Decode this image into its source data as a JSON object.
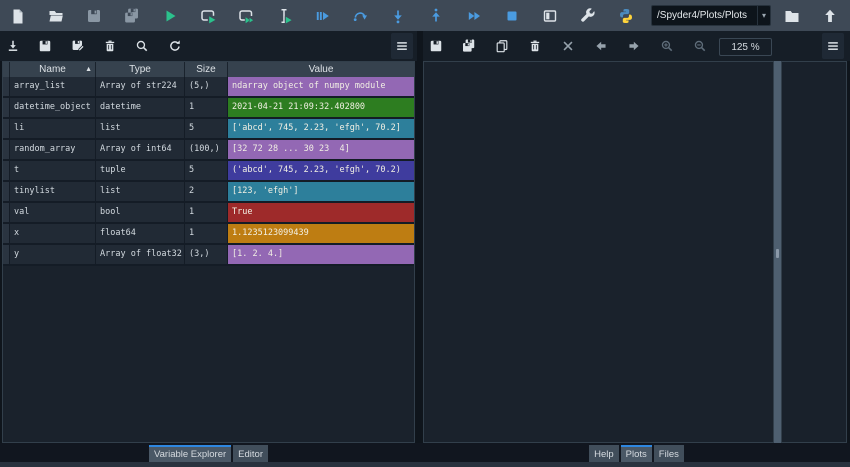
{
  "main_toolbar": {
    "icons": [
      "new-file",
      "open-file",
      "save",
      "save-all",
      "run",
      "run-cell",
      "run-cell-advance",
      "run-selection",
      "debug-file",
      "rerun-cell",
      "step-into",
      "step-return",
      "continue",
      "stop",
      "maximize-pane",
      "preferences",
      "python-logo",
      "open-directory",
      "go-up"
    ],
    "path_selector": {
      "value": "/Spyder4/Plots/Plots",
      "dropdown_glyph": "▾"
    }
  },
  "variable_explorer": {
    "toolbar_icons": [
      "import-data",
      "save-data",
      "save-data-as",
      "remove-variables",
      "search",
      "refresh",
      "options-menu"
    ],
    "table": {
      "columns": [
        "Name",
        "Type",
        "Size",
        "Value"
      ],
      "sort_column": "Name",
      "sort_glyph": "▲",
      "rows": [
        {
          "name": "array_list",
          "type": "Array of str224",
          "size": "(5,)",
          "value": "ndarray object of numpy module",
          "color": "#9368b4"
        },
        {
          "name": "datetime_object",
          "type": "datetime",
          "size": "1",
          "value": "2021-04-21 21:09:32.402800",
          "color": "#2d7d20"
        },
        {
          "name": "li",
          "type": "list",
          "size": "5",
          "value": "['abcd', 745, 2.23, 'efgh', 70.2]",
          "color": "#2d7f9b"
        },
        {
          "name": "random_array",
          "type": "Array of int64",
          "size": "(100,)",
          "value": "[32 72 28 ... 30 23  4]",
          "color": "#9368b4"
        },
        {
          "name": "t",
          "type": "tuple",
          "size": "5",
          "value": "('abcd', 745, 2.23, 'efgh', 70.2)",
          "color": "#3f3c9e"
        },
        {
          "name": "tinylist",
          "type": "list",
          "size": "2",
          "value": "[123, 'efgh']",
          "color": "#2d7f9b"
        },
        {
          "name": "val",
          "type": "bool",
          "size": "1",
          "value": "True",
          "color": "#9e2a2a"
        },
        {
          "name": "x",
          "type": "float64",
          "size": "1",
          "value": "1.1235123099439",
          "color": "#be7d12"
        },
        {
          "name": "y",
          "type": "Array of float32",
          "size": "(3,)",
          "value": "[1. 2. 4.]",
          "color": "#9368b4"
        }
      ]
    },
    "tabs": [
      {
        "label": "Variable Explorer",
        "selected": true
      },
      {
        "label": "Editor",
        "selected": false
      }
    ]
  },
  "plots_pane": {
    "toolbar_icons": [
      "save-plot",
      "save-all-plots",
      "copy-plot",
      "remove-plot",
      "close-all-plots",
      "previous-plot",
      "next-plot",
      "zoom-in",
      "zoom-out",
      "options-menu"
    ],
    "zoom_level": "125 %",
    "tabs": [
      {
        "label": "Help",
        "selected": false
      },
      {
        "label": "Plots",
        "selected": true
      },
      {
        "label": "Files",
        "selected": false
      }
    ]
  }
}
